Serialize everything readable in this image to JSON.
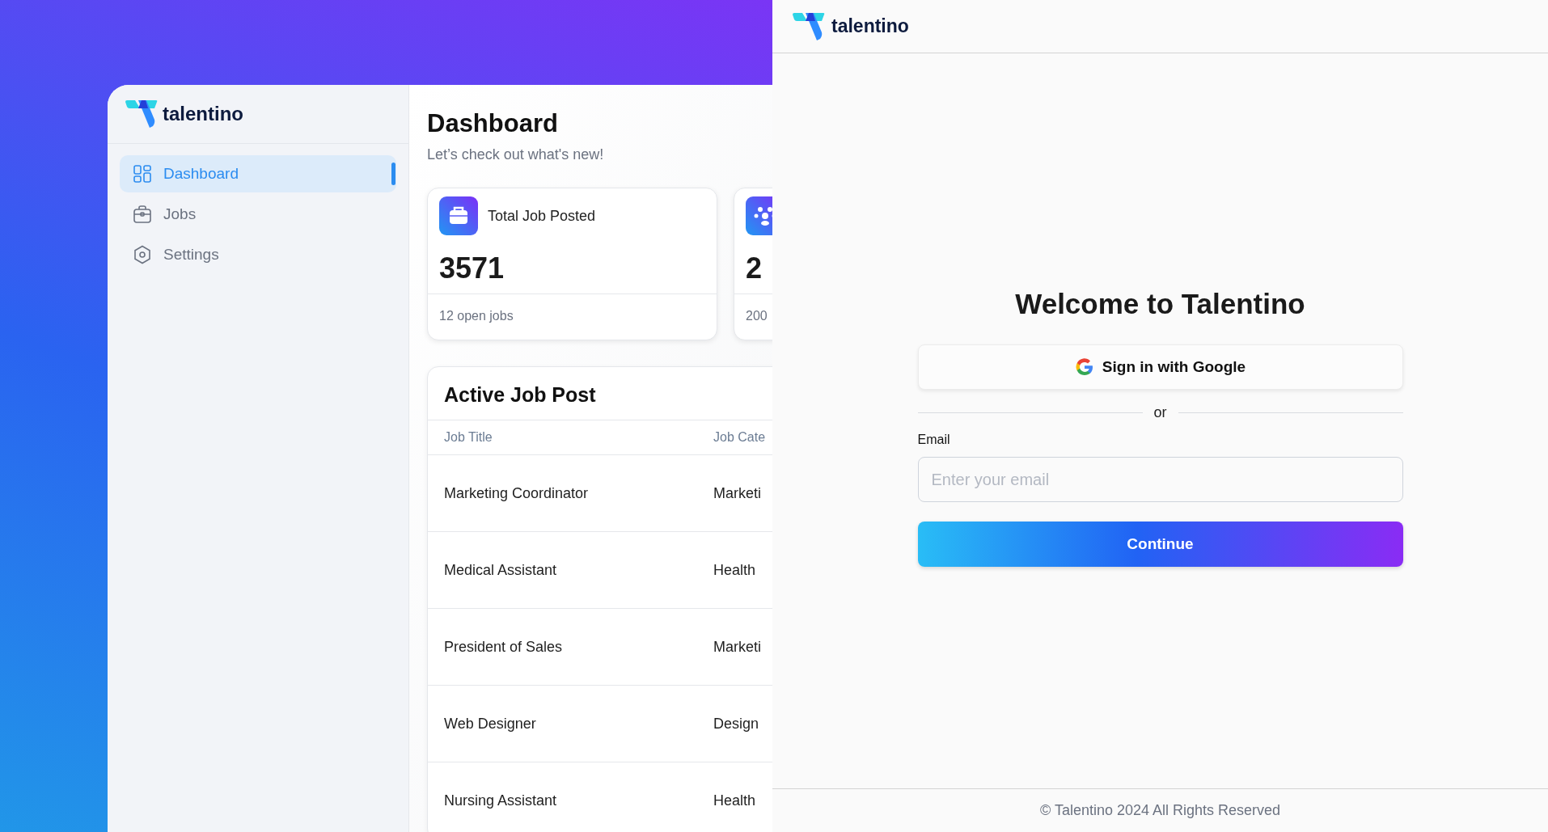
{
  "dashboard_preview": {
    "logo": {
      "wordmark": "talentino"
    },
    "sidebar": {
      "items": [
        {
          "label": "Dashboard",
          "kind": "grid",
          "selected": true
        },
        {
          "label": "Jobs",
          "kind": "briefcase",
          "selected": false
        },
        {
          "label": "Settings",
          "kind": "hexagon",
          "selected": false
        }
      ]
    },
    "main": {
      "title": "Dashboard",
      "subtitle": "Let’s check out what's new!",
      "stat_cards": [
        {
          "kind": "briefcase",
          "title": "Total Job Posted",
          "value": "3571",
          "footnote": "12 open jobs"
        },
        {
          "kind": "people",
          "value": "2",
          "footnote": "200"
        }
      ],
      "table": {
        "title": "Active Job Post",
        "columns": [
          "Job Title",
          "Job Cate"
        ],
        "rows": [
          [
            "Marketing Coordinator",
            "Marketi"
          ],
          [
            "Medical Assistant",
            "Health"
          ],
          [
            "President of Sales",
            "Marketi"
          ],
          [
            "Web Designer",
            "Design"
          ],
          [
            "Nursing Assistant",
            "Health"
          ]
        ]
      }
    }
  },
  "login": {
    "logo": {
      "wordmark": "talentino"
    },
    "title": "Welcome to Talentino",
    "google_button": "Sign in with Google",
    "divider": "or",
    "email": {
      "label": "Email",
      "placeholder": "Enter your email"
    },
    "continue_button": "Continue",
    "footer": "© Talentino 2024 All Rights Reserved"
  }
}
